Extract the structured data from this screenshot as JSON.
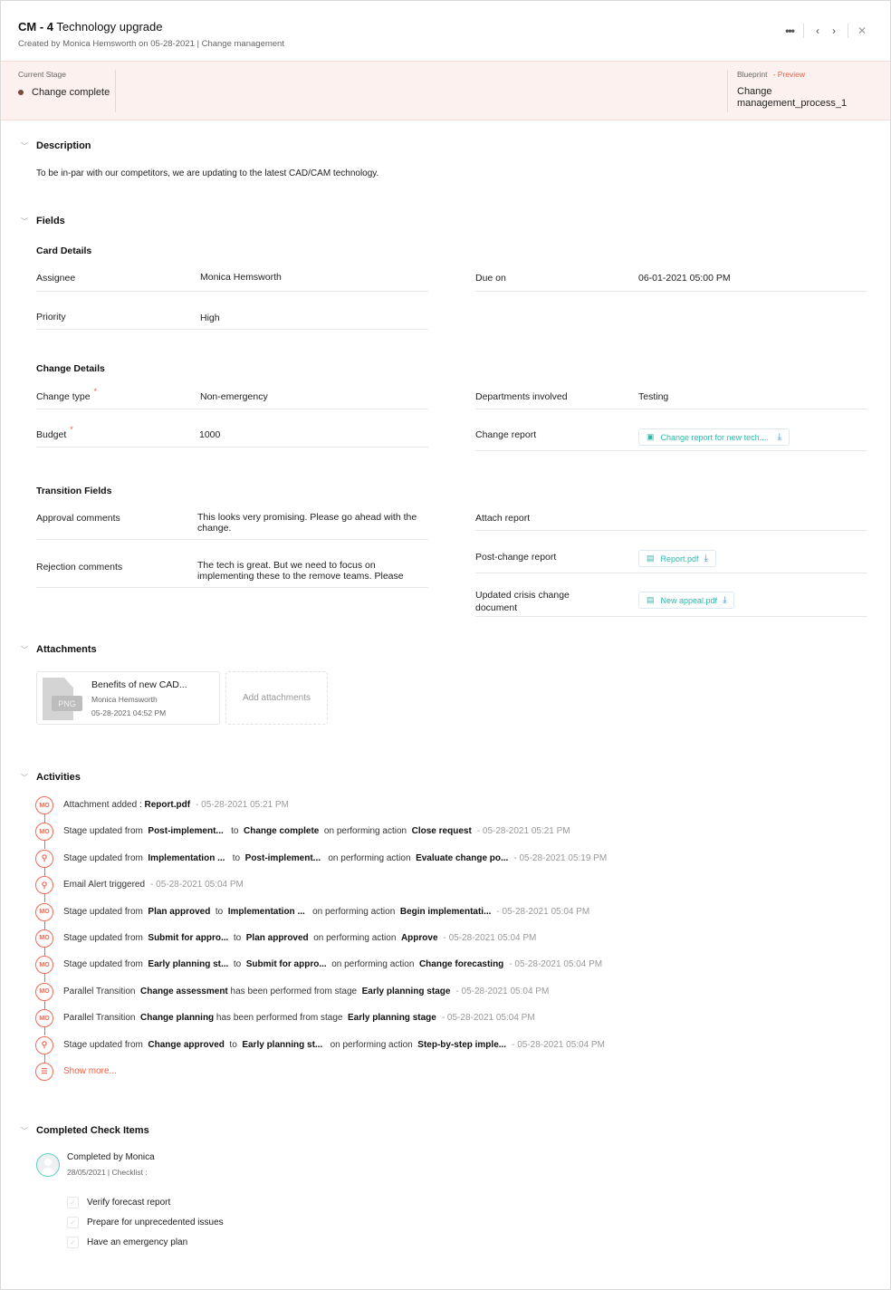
{
  "header": {
    "id": "CM - 4",
    "title": "Technology upgrade",
    "subtitle": "Created by  Monica Hemsworth  on 05-28-2021 | Change management",
    "actions": {
      "more_icon": "more-horizontal-icon",
      "prev_icon": "chevron-left-icon",
      "next_icon": "chevron-right-icon",
      "close_icon": "close-icon"
    }
  },
  "stage": {
    "label": "Current Stage",
    "value": "Change complete",
    "dot_color": "#7a4a3a"
  },
  "blueprint": {
    "label": "Blueprint",
    "preview": "- Preview",
    "value": "Change management_process_1"
  },
  "description": {
    "title": "Description",
    "text": "To be in-par with our competitors, we are updating to the latest CAD/CAM technology."
  },
  "fields": {
    "title": "Fields",
    "card_details": {
      "title": "Card Details",
      "assignee_label": "Assignee",
      "assignee_value": "Monica Hemsworth",
      "due_label": "Due on",
      "due_value": "06-01-2021 05:00 PM",
      "priority_label": "Priority",
      "priority_value": "High"
    },
    "change_details": {
      "title": "Change Details",
      "change_type_label": "Change type",
      "change_type_value": "Non-emergency",
      "departments_label": "Departments involved",
      "departments_value": "Testing",
      "budget_label": "Budget",
      "budget_value": "1000",
      "change_report_label": "Change report",
      "change_report_file": "Change report for new tech....",
      "required_mark": "*"
    },
    "transition_fields": {
      "title": "Transition Fields",
      "approval_label": "Approval comments",
      "approval_value": "This looks very promising. Please go ahead with the change.",
      "attach_report_label": "Attach report",
      "rejection_label": "Rejection comments",
      "rejection_value": "The tech is great. But we need to focus on implementing these to the remove teams. Please",
      "post_change_label": "Post-change report",
      "post_change_file": "Report.pdf",
      "crisis_label": "Updated crisis change document",
      "crisis_file": "New appeal.pdf"
    }
  },
  "attachments": {
    "title": "Attachments",
    "items": [
      {
        "name": "Benefits of new CAD...",
        "type": "PNG",
        "by": "Monica Hemsworth",
        "date": "05-28-2021 04:52 PM"
      }
    ],
    "add_label": "Add attachments"
  },
  "activities": {
    "title": "Activities",
    "items": [
      {
        "avatar": "MO",
        "parts": [
          [
            "t",
            "Attachment added : "
          ],
          [
            "b",
            "Report.pdf"
          ]
        ],
        "ts": "- 05-28-2021 05:21 PM"
      },
      {
        "avatar": "MO",
        "parts": [
          [
            "t",
            "Stage updated from  "
          ],
          [
            "b",
            "Post-implement..."
          ],
          [
            "t",
            "   to  "
          ],
          [
            "b",
            "Change complete"
          ],
          [
            "t",
            "  on performing action  "
          ],
          [
            "b",
            "Close request"
          ]
        ],
        "ts": "- 05-28-2021 05:21 PM"
      },
      {
        "avatar": "key-icon",
        "parts": [
          [
            "t",
            "Stage updated from  "
          ],
          [
            "b",
            "Implementation ..."
          ],
          [
            "t",
            "   to  "
          ],
          [
            "b",
            "Post-implement..."
          ],
          [
            "t",
            "   on performing action  "
          ],
          [
            "b",
            "Evaluate change po..."
          ]
        ],
        "ts": "- 05-28-2021 05:19 PM"
      },
      {
        "avatar": "key-icon",
        "parts": [
          [
            "t",
            "Email Alert triggered"
          ]
        ],
        "ts": "- 05-28-2021 05:04 PM"
      },
      {
        "avatar": "MO",
        "parts": [
          [
            "t",
            "Stage updated from  "
          ],
          [
            "b",
            "Plan approved"
          ],
          [
            "t",
            "  to  "
          ],
          [
            "b",
            "Implementation ..."
          ],
          [
            "t",
            "   on performing action  "
          ],
          [
            "b",
            "Begin implementati..."
          ]
        ],
        "ts": "- 05-28-2021 05:04 PM"
      },
      {
        "avatar": "MO",
        "parts": [
          [
            "t",
            "Stage updated from  "
          ],
          [
            "b",
            "Submit for appro..."
          ],
          [
            "t",
            "  to  "
          ],
          [
            "b",
            "Plan approved"
          ],
          [
            "t",
            "  on performing action  "
          ],
          [
            "b",
            "Approve"
          ]
        ],
        "ts": "- 05-28-2021 05:04 PM"
      },
      {
        "avatar": "MO",
        "parts": [
          [
            "t",
            "Stage updated from  "
          ],
          [
            "b",
            "Early planning st..."
          ],
          [
            "t",
            "  to  "
          ],
          [
            "b",
            "Submit for appro..."
          ],
          [
            "t",
            "  on performing action  "
          ],
          [
            "b",
            "Change forecasting"
          ]
        ],
        "ts": "- 05-28-2021 05:04 PM"
      },
      {
        "avatar": "MO",
        "parts": [
          [
            "t",
            "Parallel Transition  "
          ],
          [
            "b",
            "Change assessment"
          ],
          [
            "t",
            " has been performed from stage  "
          ],
          [
            "b",
            "Early planning stage"
          ]
        ],
        "ts": "- 05-28-2021 05:04 PM"
      },
      {
        "avatar": "MO",
        "parts": [
          [
            "t",
            "Parallel Transition  "
          ],
          [
            "b",
            "Change planning"
          ],
          [
            "t",
            " has been performed from stage  "
          ],
          [
            "b",
            "Early planning stage"
          ]
        ],
        "ts": "- 05-28-2021 05:04 PM"
      },
      {
        "avatar": "key-icon",
        "parts": [
          [
            "t",
            "Stage updated from  "
          ],
          [
            "b",
            "Change approved"
          ],
          [
            "t",
            "  to  "
          ],
          [
            "b",
            "Early planning st..."
          ],
          [
            "t",
            "   on performing action  "
          ],
          [
            "b",
            "Step-by-step imple..."
          ]
        ],
        "ts": "- 05-28-2021 05:04 PM"
      }
    ],
    "show_more": "Show more...",
    "accent": "#f06b55"
  },
  "checklist": {
    "title": "Completed Check Items",
    "completed_by": "Completed by Monica",
    "meta": "28/05/2021 | Checklist :",
    "items": [
      {
        "label": "Verify forecast report",
        "checked": true
      },
      {
        "label": "Prepare for unprecedented issues",
        "checked": true
      },
      {
        "label": "Have an emergency plan",
        "checked": true
      }
    ]
  }
}
